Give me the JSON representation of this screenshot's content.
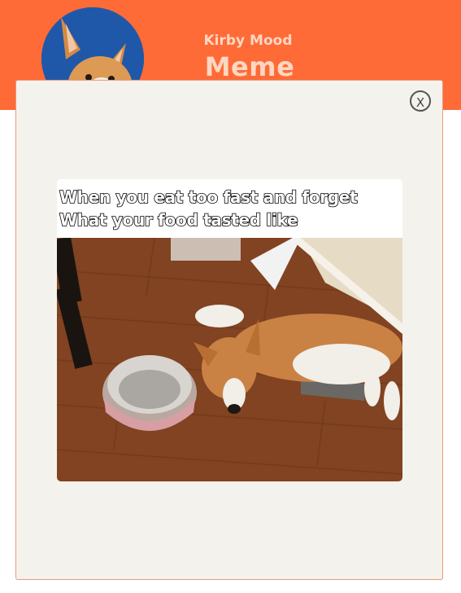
{
  "header": {
    "subtitle": "Kirby Mood",
    "title": "Meme Picker",
    "background_color": "#fe6b37",
    "avatar_icon": "corgi-avatar"
  },
  "modal": {
    "close_label": "X",
    "meme": {
      "caption_lines": [
        "When you eat too fast and forget",
        "What your food tasted like"
      ]
    }
  }
}
